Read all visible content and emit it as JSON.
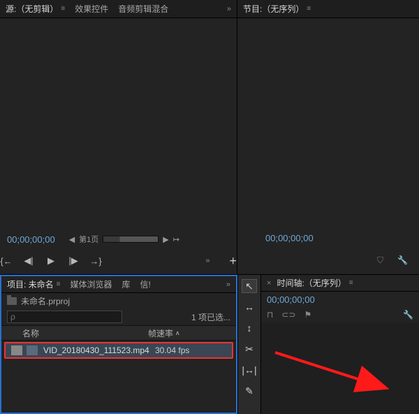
{
  "source": {
    "tab_label": "源:（无剪辑）",
    "tab_fx": "效果控件",
    "tab_audio": "音频剪辑混合",
    "timecode": "00;00;00;00",
    "page_label": "第1页"
  },
  "program": {
    "tab_label": "节目:（无序列）",
    "timecode": "00;00;00;00"
  },
  "project": {
    "tab_project": "项目: 未命名",
    "tab_browser": "媒体浏览器",
    "tab_lib": "库",
    "tab_info": "信!",
    "file_name": "未命名.prproj",
    "search_placeholder": "ρ",
    "item_count": "1 项已选...",
    "col_name": "名称",
    "col_fps": "帧速率",
    "media": {
      "name": "VID_20180430_111523.mp4",
      "fps": "30.04 fps"
    }
  },
  "timeline": {
    "tab_label": "时间轴:（无序列）",
    "timecode": "00;00;00;00"
  },
  "icons": {
    "menu": "≡",
    "overflow": "»",
    "mark_in": "{←",
    "step_back": "◀|",
    "play": "▶",
    "step_fwd": "|▶",
    "mark_out": "→}",
    "plus": "+",
    "shield": "⛉",
    "wrench": "🔧",
    "tool_select": "↖",
    "tool_track": "↔",
    "tool_ripple": "↕",
    "tool_razor": "✂",
    "tool_slip": "|↔|",
    "tool_pen": "✎",
    "snap_toggle": "⊓",
    "link_toggle": "⊂⊃",
    "marker_tool": "⚑",
    "settings": "🔧"
  }
}
